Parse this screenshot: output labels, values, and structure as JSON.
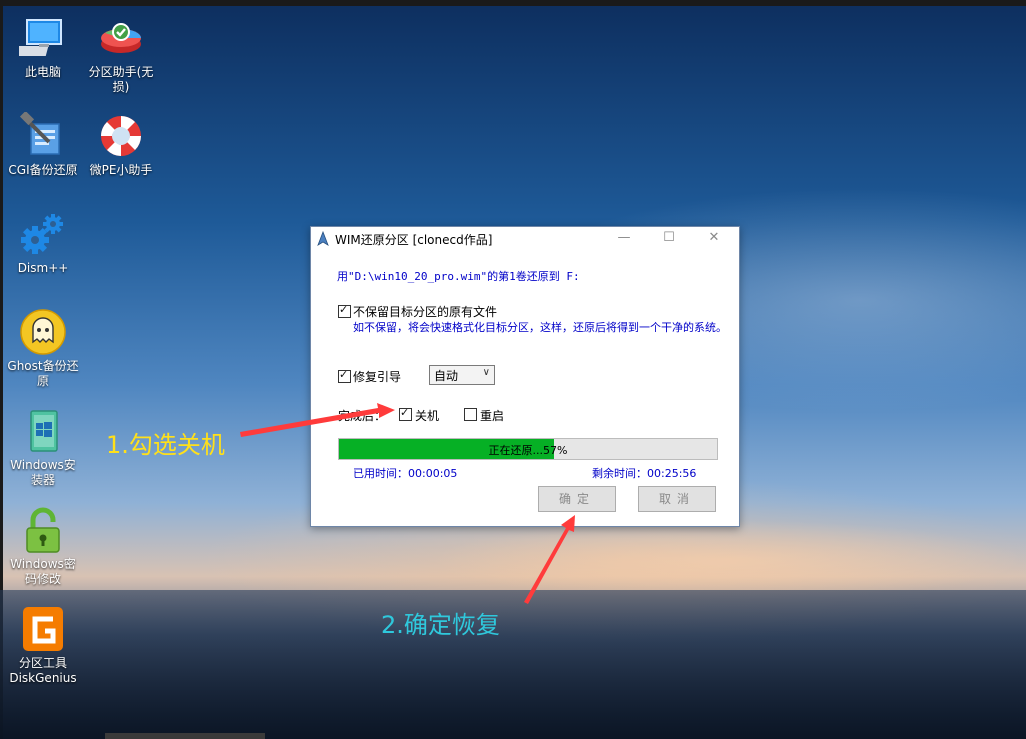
{
  "desktop": {
    "icons": [
      {
        "label": "此电脑",
        "icon": "computer-icon"
      },
      {
        "label": "分区助手(无损)",
        "icon": "partition-assistant-icon"
      },
      {
        "label": "CGI备份还原",
        "icon": "cgi-backup-icon"
      },
      {
        "label": "微PE小助手",
        "icon": "lifebuoy-icon"
      },
      {
        "label": "Dism++",
        "icon": "gears-icon"
      },
      {
        "label": "Ghost备份还原",
        "icon": "ghost-icon"
      },
      {
        "label": "Windows安装器",
        "icon": "windows-installer-icon"
      },
      {
        "label": "Windows密码修改",
        "icon": "padlock-icon"
      },
      {
        "label": "分区工具DiskGenius",
        "icon": "diskgenius-icon"
      }
    ]
  },
  "dialog": {
    "title": "WIM还原分区  [clonecd作品]",
    "window_buttons": {
      "minimize": "—",
      "maximize": "☐",
      "close": "✕"
    },
    "source_line": "用\"D:\\win10_20_pro.wim\"的第1卷还原到 F:",
    "keep_files": {
      "checked": true,
      "label": "不保留目标分区的原有文件"
    },
    "hint": "如不保留，将会快速格式化目标分区，这样，还原后将得到一个干净的系统。",
    "repair_boot": {
      "checked": true,
      "label": "修复引导",
      "selected": "自动"
    },
    "after_done": {
      "label": "完成后：",
      "shutdown": {
        "checked": true,
        "label": "关机"
      },
      "restart": {
        "checked": false,
        "label": "重启"
      }
    },
    "progress": {
      "percent": 57,
      "text": "正在还原...57%"
    },
    "elapsed": "已用时间：00:00:05",
    "remaining": "剩余时间：00:25:56",
    "ok_label": "确定",
    "cancel_label": "取消"
  },
  "annotations": [
    {
      "text": "1.勾选关机",
      "color": "#ffe01a"
    },
    {
      "text": "2.确定恢复",
      "color": "#2fc8dc"
    }
  ],
  "colors": {
    "arrow": "#ff3b3b",
    "progress": "#06b025",
    "dialog_blue_text": "#0000c8"
  }
}
